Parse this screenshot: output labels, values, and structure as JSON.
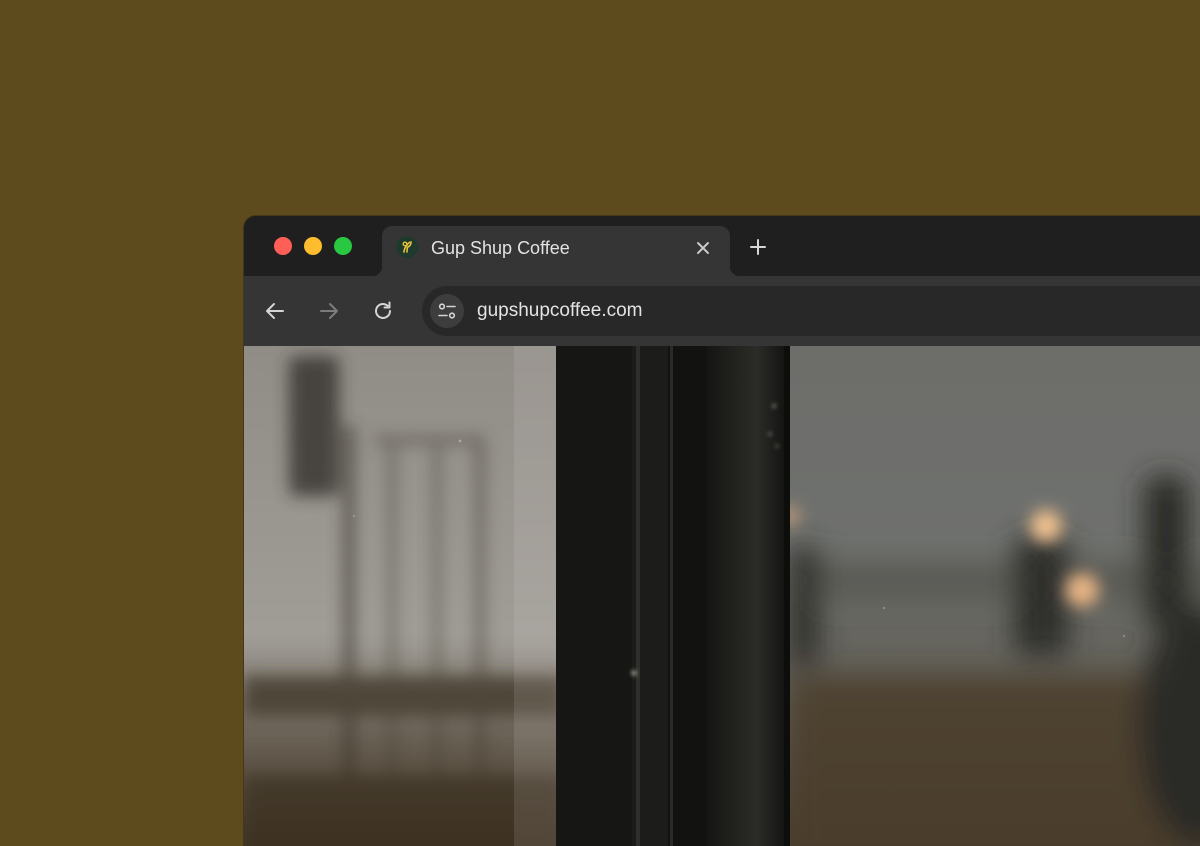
{
  "colors": {
    "background": "#5d4b1d",
    "close_light": "#ff5f57",
    "minimize_light": "#febc2e",
    "zoom_light": "#28c840",
    "titlebar": "#1f1f1f",
    "toolbar": "#353535",
    "omnibox": "#282828"
  },
  "window_controls": {
    "close_icon": "window-close-icon",
    "minimize_icon": "window-minimize-icon",
    "zoom_icon": "window-zoom-icon"
  },
  "tab": {
    "title": "Gup Shup Coffee",
    "favicon": "coffee-logo-icon",
    "close_icon": "close-icon"
  },
  "new_tab_icon": "plus-icon",
  "toolbar": {
    "back_icon": "arrow-left-icon",
    "forward_icon": "arrow-right-icon",
    "reload_icon": "reload-icon"
  },
  "address_bar": {
    "site_info_icon": "tune-icon",
    "url": "gupshupcoffee.com"
  }
}
